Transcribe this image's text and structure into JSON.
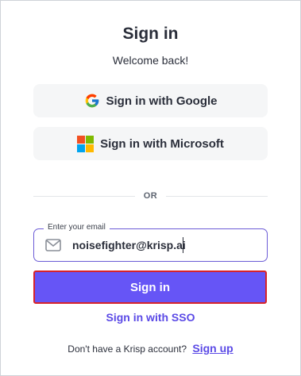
{
  "header": {
    "title": "Sign in",
    "subtitle": "Welcome back!"
  },
  "providers": {
    "google_label": "Sign in with Google",
    "microsoft_label": "Sign in with Microsoft"
  },
  "divider": {
    "text": "OR"
  },
  "email": {
    "legend": "Enter your email",
    "value": "noisefighter@krisp.ai"
  },
  "actions": {
    "signin_label": "Sign in",
    "sso_label": "Sign in with SSO"
  },
  "footer": {
    "prompt": "Don't have a Krisp account?",
    "signup_label": "Sign up"
  },
  "colors": {
    "accent": "#6655f6",
    "link": "#5b4ae6",
    "highlight_border": "#d7222a"
  }
}
